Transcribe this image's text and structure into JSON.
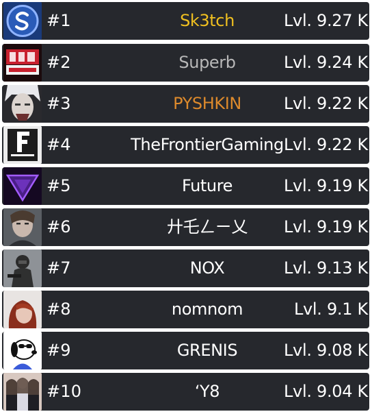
{
  "colors": {
    "row_bg": "#26282d",
    "text": "#ffffff",
    "gold": "#f0c020",
    "silver": "#b8b8b8",
    "bronze": "#dd8a2c"
  },
  "entries": [
    {
      "rank": "#1",
      "name": "Sk3tch",
      "level": "Lvl. 9.27 K",
      "name_color": "#f0c020",
      "avatar_icon": "s-logo-icon"
    },
    {
      "rank": "#2",
      "name": "Superb",
      "level": "Lvl. 9.24 K",
      "name_color": "#b8b8b8",
      "avatar_icon": "png-makoni-logo-icon"
    },
    {
      "rank": "#3",
      "name": "PYSHKIN",
      "level": "Lvl. 9.22 K",
      "name_color": "#dd8a2c",
      "avatar_icon": "face-avatar-icon"
    },
    {
      "rank": "#4",
      "name": "TheFrontierGaming",
      "level": "Lvl. 9.22 K",
      "name_color": "#ffffff",
      "avatar_icon": "frontier-logo-icon"
    },
    {
      "rank": "#5",
      "name": "Future",
      "level": "Lvl. 9.19 K",
      "name_color": "#ffffff",
      "avatar_icon": "purple-triangle-icon"
    },
    {
      "rank": "#6",
      "name": "廾乇ㄥㄧ乂",
      "level": "Lvl. 9.19 K",
      "name_color": "#ffffff",
      "avatar_icon": "portrait-avatar-icon"
    },
    {
      "rank": "#7",
      "name": "NOX",
      "level": "Lvl. 9.13 K",
      "name_color": "#ffffff",
      "avatar_icon": "soldier-avatar-icon"
    },
    {
      "rank": "#8",
      "name": "nomnom",
      "level": "Lvl. 9.1 K",
      "name_color": "#ffffff",
      "avatar_icon": "redhead-avatar-icon"
    },
    {
      "rank": "#9",
      "name": "GRENIS",
      "level": "Lvl. 9.08 K",
      "name_color": "#ffffff",
      "avatar_icon": "snoopy-avatar-icon"
    },
    {
      "rank": "#10",
      "name": "‘Y8",
      "level": "Lvl. 9.04 K",
      "name_color": "#ffffff",
      "avatar_icon": "group-photo-avatar-icon"
    }
  ]
}
